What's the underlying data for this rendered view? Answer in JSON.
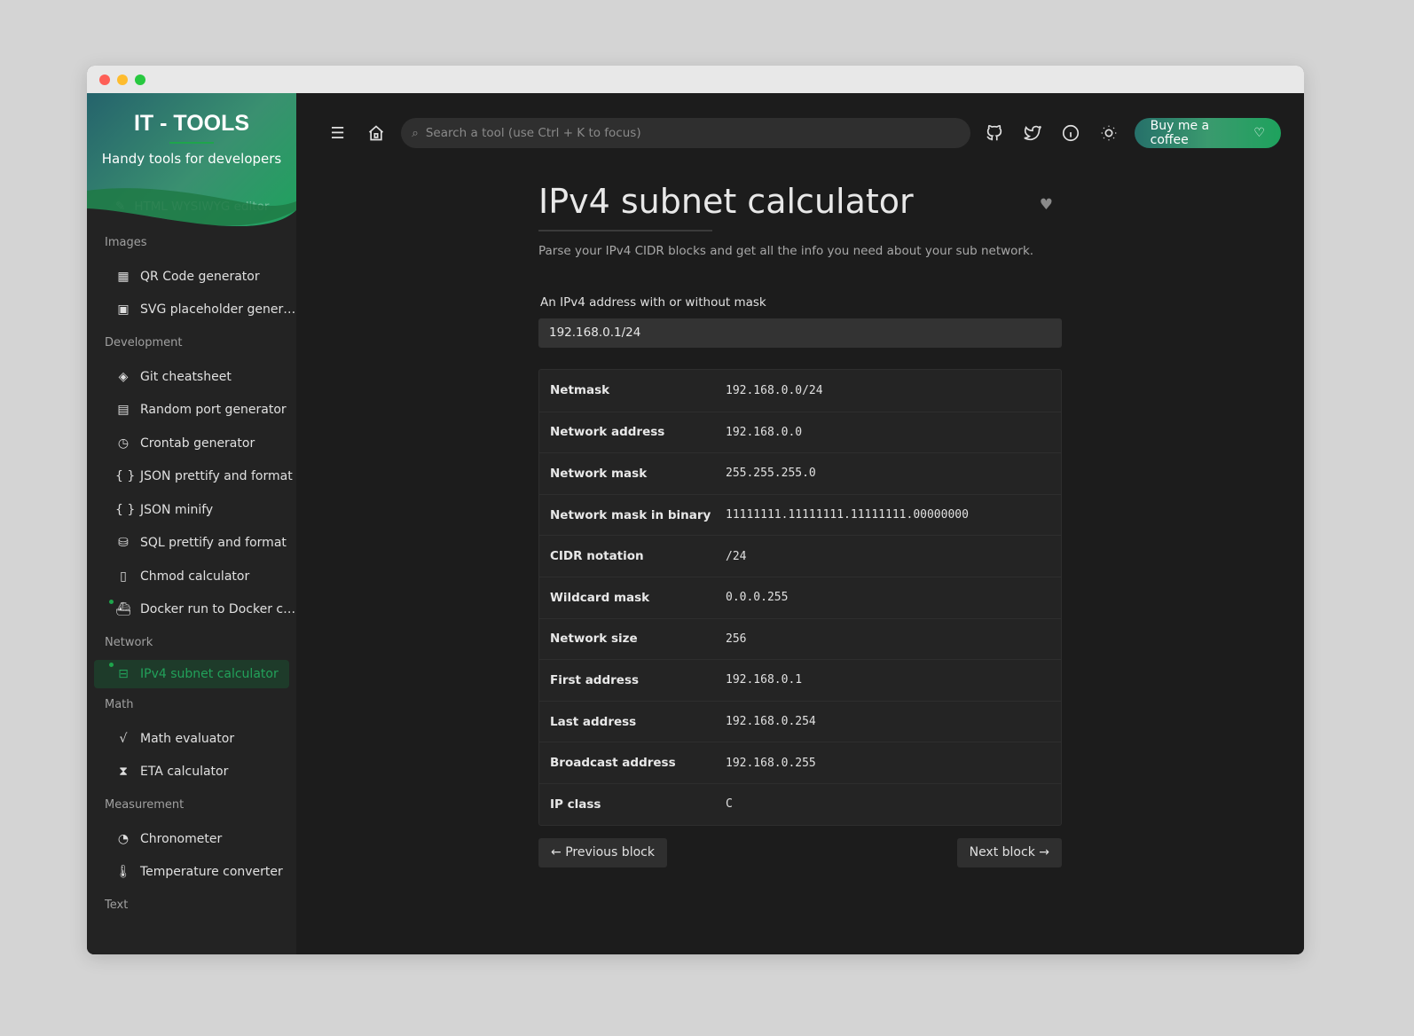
{
  "window": {
    "controls": [
      "close",
      "minimize",
      "maximize"
    ]
  },
  "sidebar": {
    "brand": "IT - TOOLS",
    "tagline": "Handy tools for developers",
    "hero_item": {
      "label": "HTML WYSIWYG editor",
      "icon": "edit-icon"
    },
    "sections": [
      {
        "title": "Images",
        "items": [
          {
            "label": "QR Code generator",
            "icon": "qr-icon"
          },
          {
            "label": "SVG placeholder gener…",
            "icon": "image-icon"
          }
        ]
      },
      {
        "title": "Development",
        "items": [
          {
            "label": "Git cheatsheet",
            "icon": "git-icon"
          },
          {
            "label": "Random port generator",
            "icon": "server-icon"
          },
          {
            "label": "Crontab generator",
            "icon": "alarm-icon"
          },
          {
            "label": "JSON prettify and format",
            "icon": "braces-icon"
          },
          {
            "label": "JSON minify",
            "icon": "braces-icon"
          },
          {
            "label": "SQL prettify and format",
            "icon": "database-icon"
          },
          {
            "label": "Chmod calculator",
            "icon": "file-icon"
          },
          {
            "label": "Docker run to Docker c…",
            "icon": "docker-icon",
            "new": true
          }
        ]
      },
      {
        "title": "Network",
        "items": [
          {
            "label": "IPv4 subnet calculator",
            "icon": "router-icon",
            "new": true,
            "active": true
          }
        ]
      },
      {
        "title": "Math",
        "items": [
          {
            "label": "Math evaluator",
            "icon": "sqrt-icon"
          },
          {
            "label": "ETA calculator",
            "icon": "hourglass-icon"
          }
        ]
      },
      {
        "title": "Measurement",
        "items": [
          {
            "label": "Chronometer",
            "icon": "stopwatch-icon"
          },
          {
            "label": "Temperature converter",
            "icon": "thermometer-icon"
          }
        ]
      },
      {
        "title": "Text",
        "items": []
      }
    ]
  },
  "header": {
    "search_placeholder": "Search a tool (use Ctrl + K to focus)",
    "coffee_label": "Buy me a coffee",
    "icons": [
      "menu-icon",
      "home-icon",
      "github-icon",
      "twitter-icon",
      "info-icon",
      "sun-icon"
    ]
  },
  "tool": {
    "title": "IPv4 subnet calculator",
    "description": "Parse your IPv4 CIDR blocks and get all the info you need about your sub network.",
    "input_label": "An IPv4 address with or without mask",
    "input_value": "192.168.0.1/24",
    "rows": [
      {
        "k": "Netmask",
        "v": "192.168.0.0/24"
      },
      {
        "k": "Network address",
        "v": "192.168.0.0"
      },
      {
        "k": "Network mask",
        "v": "255.255.255.0"
      },
      {
        "k": "Network mask in binary",
        "v": "11111111.11111111.11111111.00000000"
      },
      {
        "k": "CIDR notation",
        "v": "/24"
      },
      {
        "k": "Wildcard mask",
        "v": "0.0.0.255"
      },
      {
        "k": "Network size",
        "v": "256"
      },
      {
        "k": "First address",
        "v": "192.168.0.1"
      },
      {
        "k": "Last address",
        "v": "192.168.0.254"
      },
      {
        "k": "Broadcast address",
        "v": "192.168.0.255"
      },
      {
        "k": "IP class",
        "v": "C"
      }
    ],
    "prev_label": "Previous block",
    "next_label": "Next block"
  },
  "colors": {
    "accent": "#1ea54c",
    "background": "#1c1c1c",
    "sidebar": "#232323"
  }
}
